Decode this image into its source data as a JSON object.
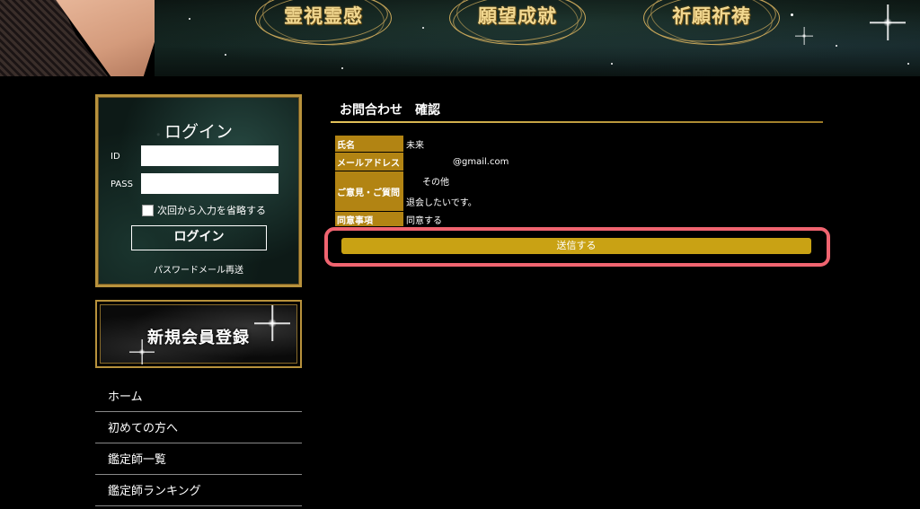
{
  "header": {
    "badges": [
      "霊視霊感",
      "願望成就",
      "祈願祈祷"
    ]
  },
  "login": {
    "title": "ログイン",
    "id_label": "ID",
    "pass_label": "PASS",
    "id_value": "",
    "pass_value": "",
    "remember_label": "次回から入力を省略する",
    "button_label": "ログイン",
    "password_resend": "パスワードメール再送"
  },
  "register": {
    "label": "新規会員登録"
  },
  "side_nav": {
    "items": [
      "ホーム",
      "初めての方へ",
      "鑑定師一覧",
      "鑑定師ランキング"
    ]
  },
  "main": {
    "title": "お問合わせ　確認",
    "rows": [
      {
        "label": "氏名",
        "value": "未来"
      },
      {
        "label": "メールアドレス",
        "value": "@gmail.com"
      },
      {
        "label": "ご意見・ご質問",
        "value": "その他",
        "value2": "退会したいです。"
      },
      {
        "label": "同意事項",
        "value": "同意する"
      }
    ],
    "submit_label": "送信する"
  },
  "colors": {
    "gold_border": "#b8923c",
    "table_header": "#b28413",
    "submit_button": "#c9a214",
    "highlight_outline": "#f06470"
  }
}
